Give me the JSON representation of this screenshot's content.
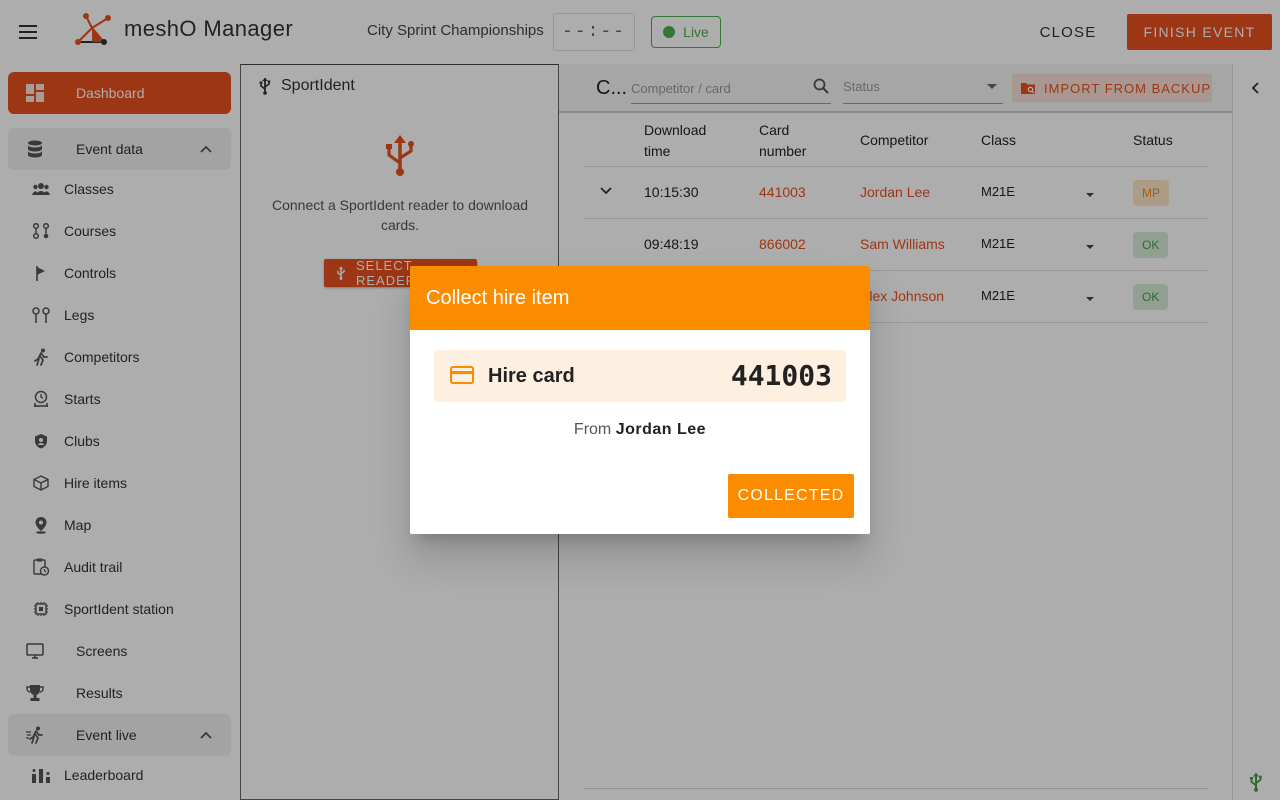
{
  "header": {
    "app_name": "meshO Manager",
    "event_name": "City Sprint Championships",
    "clock": "--:--",
    "live_label": "Live",
    "close_label": "CLOSE",
    "finish_label": "FINISH EVENT"
  },
  "sidebar": {
    "dashboard": "Dashboard",
    "event_data": "Event data",
    "event_data_items": [
      "Classes",
      "Courses",
      "Controls",
      "Legs",
      "Competitors",
      "Starts",
      "Clubs",
      "Hire items",
      "Map",
      "Audit trail",
      "SportIdent station"
    ],
    "screens": "Screens",
    "results": "Results",
    "event_live": "Event live",
    "leaderboard": "Leaderboard"
  },
  "sportident": {
    "title": "SportIdent",
    "message": "Connect a SportIdent reader to download cards.",
    "select_label": "SELECT READER"
  },
  "main": {
    "title": "C...",
    "search_placeholder": "Competitor / card",
    "status_placeholder": "Status",
    "import_label": "IMPORT FROM BACKUP",
    "columns": {
      "download_time_1": "Download",
      "download_time_2": "time",
      "card_1": "Card",
      "card_2": "number",
      "competitor": "Competitor",
      "class": "Class",
      "status": "Status"
    },
    "rows": [
      {
        "time": "10:15:30",
        "card": "441003",
        "competitor": "Jordan Lee",
        "class": "M21E",
        "status": "MP"
      },
      {
        "time": "09:48:19",
        "card": "866002",
        "competitor": "Sam Williams",
        "class": "M21E",
        "status": "OK"
      },
      {
        "time": "",
        "card": "",
        "competitor": "Alex Johnson",
        "class": "M21E",
        "status": "OK"
      }
    ]
  },
  "dialog": {
    "title": "Collect hire item",
    "item_label": "Hire card",
    "item_number": "441003",
    "from_label": "From",
    "from_name": "Jordan Lee",
    "button_label": "COLLECTED"
  },
  "colors": {
    "brand": "#e8501e",
    "dialog_accent": "#fb8c00",
    "live": "#4caf50"
  }
}
